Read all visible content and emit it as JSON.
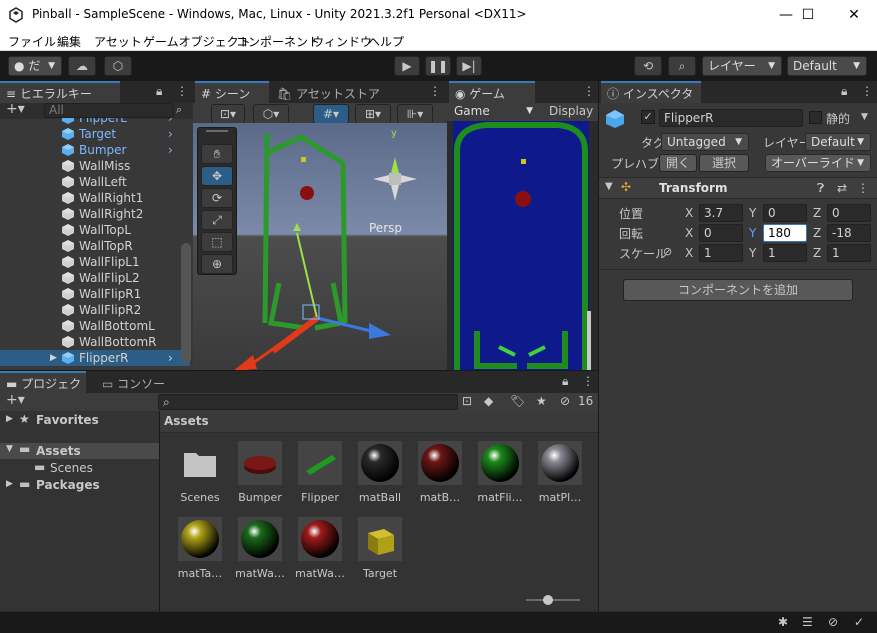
{
  "window": {
    "title": "Pinball - SampleScene - Windows, Mac, Linux - Unity 2021.3.2f1 Personal <DX11>",
    "controls": [
      "—",
      "☐",
      "✕"
    ]
  },
  "menu": [
    "ファイル",
    "編集",
    "アセット",
    "ゲームオブジェクト",
    "コンポーネント",
    "ウィンドウ",
    "ヘルプ"
  ],
  "toolbar": {
    "account_label": "だ",
    "layers_label": "レイヤー",
    "layout_label": "Default"
  },
  "hierarchy": {
    "tab": "ヒエラルキー",
    "search_placeholder": "All",
    "items": [
      {
        "label": "FlipperL",
        "blue": true,
        "prefab": true
      },
      {
        "label": "Target",
        "blue": true,
        "prefab": true
      },
      {
        "label": "Bumper",
        "blue": true,
        "prefab": true
      },
      {
        "label": "WallMiss",
        "blue": false
      },
      {
        "label": "WallLeft",
        "blue": false
      },
      {
        "label": "WallRight1",
        "blue": false
      },
      {
        "label": "WallRight2",
        "blue": false
      },
      {
        "label": "WallTopL",
        "blue": false
      },
      {
        "label": "WallTopR",
        "blue": false
      },
      {
        "label": "WallFlipL1",
        "blue": false
      },
      {
        "label": "WallFlipL2",
        "blue": false
      },
      {
        "label": "WallFlipR1",
        "blue": false
      },
      {
        "label": "WallFlipR2",
        "blue": false
      },
      {
        "label": "WallBottomL",
        "blue": false
      },
      {
        "label": "WallBottomR",
        "blue": false
      },
      {
        "label": "FlipperR",
        "blue": false,
        "prefab": true,
        "selected": true
      }
    ]
  },
  "scene": {
    "tab_scene": "シーン",
    "tab_store": "アセットストア",
    "persp": "Persp",
    "gizmo_y": "y"
  },
  "game": {
    "tab": "ゲーム",
    "display_label": "Game",
    "display_right": "Display"
  },
  "inspector": {
    "tab": "インスペクター",
    "object_name": "FlipperR",
    "static_label": "静的",
    "tag_label": "タグ",
    "tag_value": "Untagged",
    "layer_label": "レイヤー",
    "layer_value": "Default",
    "prefab_label": "プレハブ",
    "open_btn": "開く",
    "select_btn": "選択",
    "override_btn": "オーバーライド",
    "transform_title": "Transform",
    "position_label": "位置",
    "rotation_label": "回転",
    "scale_label": "スケール",
    "axis_x": "X",
    "axis_y": "Y",
    "axis_z": "Z",
    "position": {
      "x": "3.7",
      "y": "0",
      "z": "0"
    },
    "rotation": {
      "x": "0",
      "y": "180",
      "z": "-18"
    },
    "scale": {
      "x": "1",
      "y": "1",
      "z": "1"
    },
    "add_component": "コンポーネントを追加"
  },
  "project": {
    "tab_project": "プロジェクト",
    "tab_console": "コンソール",
    "hidden_count": "16",
    "favorites": "Favorites",
    "assets_root": "Assets",
    "scenes_folder": "Scenes",
    "packages": "Packages",
    "breadcrumb": "Assets",
    "assets": [
      {
        "name": "Scenes",
        "kind": "folder"
      },
      {
        "name": "Bumper",
        "kind": "bumper"
      },
      {
        "name": "Flipper",
        "kind": "flipper"
      },
      {
        "name": "matBall",
        "kind": "sphere",
        "color": "#2a2a2a"
      },
      {
        "name": "matB…",
        "kind": "sphere",
        "color": "#6e1616"
      },
      {
        "name": "matFli…",
        "kind": "sphere",
        "color": "#1c8a1c"
      },
      {
        "name": "matPl…",
        "kind": "sphere",
        "color": "#8a8a94"
      },
      {
        "name": "matTa…",
        "kind": "sphere",
        "color": "#b0a218"
      },
      {
        "name": "matWa…",
        "kind": "sphere",
        "color": "#1a6a1a"
      },
      {
        "name": "matWa…",
        "kind": "sphere",
        "color": "#a01a1a"
      },
      {
        "name": "Target",
        "kind": "cubey"
      }
    ]
  },
  "colors": {
    "accent": "#3a79bb",
    "selection": "#2c5d87",
    "game_bg": "#0e1a8c",
    "wall_green": "#1e8c1e"
  }
}
